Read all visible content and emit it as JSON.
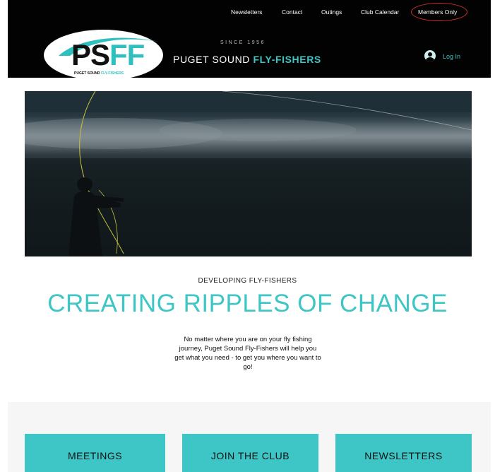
{
  "nav": {
    "items": [
      "Newsletters",
      "Contact",
      "Outings",
      "Club Calendar",
      "Members Only"
    ]
  },
  "logo": {
    "letters_dark": "PS",
    "letters_teal": "FF",
    "sub_dark": "PUGET SOUND ",
    "sub_teal": "FLY-FISHERS"
  },
  "brand": {
    "since": "SINCE 1956",
    "title_plain": "PUGET SOUND ",
    "title_accent": "FLY-FISHERS"
  },
  "account": {
    "login_label": "Log In"
  },
  "intro_section": {
    "eyebrow": "DEVELOPING FLY-FISHERS",
    "headline": "CREATING RIPPLES OF CHANGE",
    "body": "No matter where you are on your fly fishing journey, Puget Sound Fly-Fishers will help you get what you need - to get you where you want to go!"
  },
  "cards": [
    {
      "label": "MEETINGS"
    },
    {
      "label": "JOIN THE CLUB"
    },
    {
      "label": "NEWSLETTERS"
    }
  ],
  "colors": {
    "accent_teal": "#3ec6c6",
    "header_bg": "#020202",
    "highlight_ring": "#c8322d"
  }
}
